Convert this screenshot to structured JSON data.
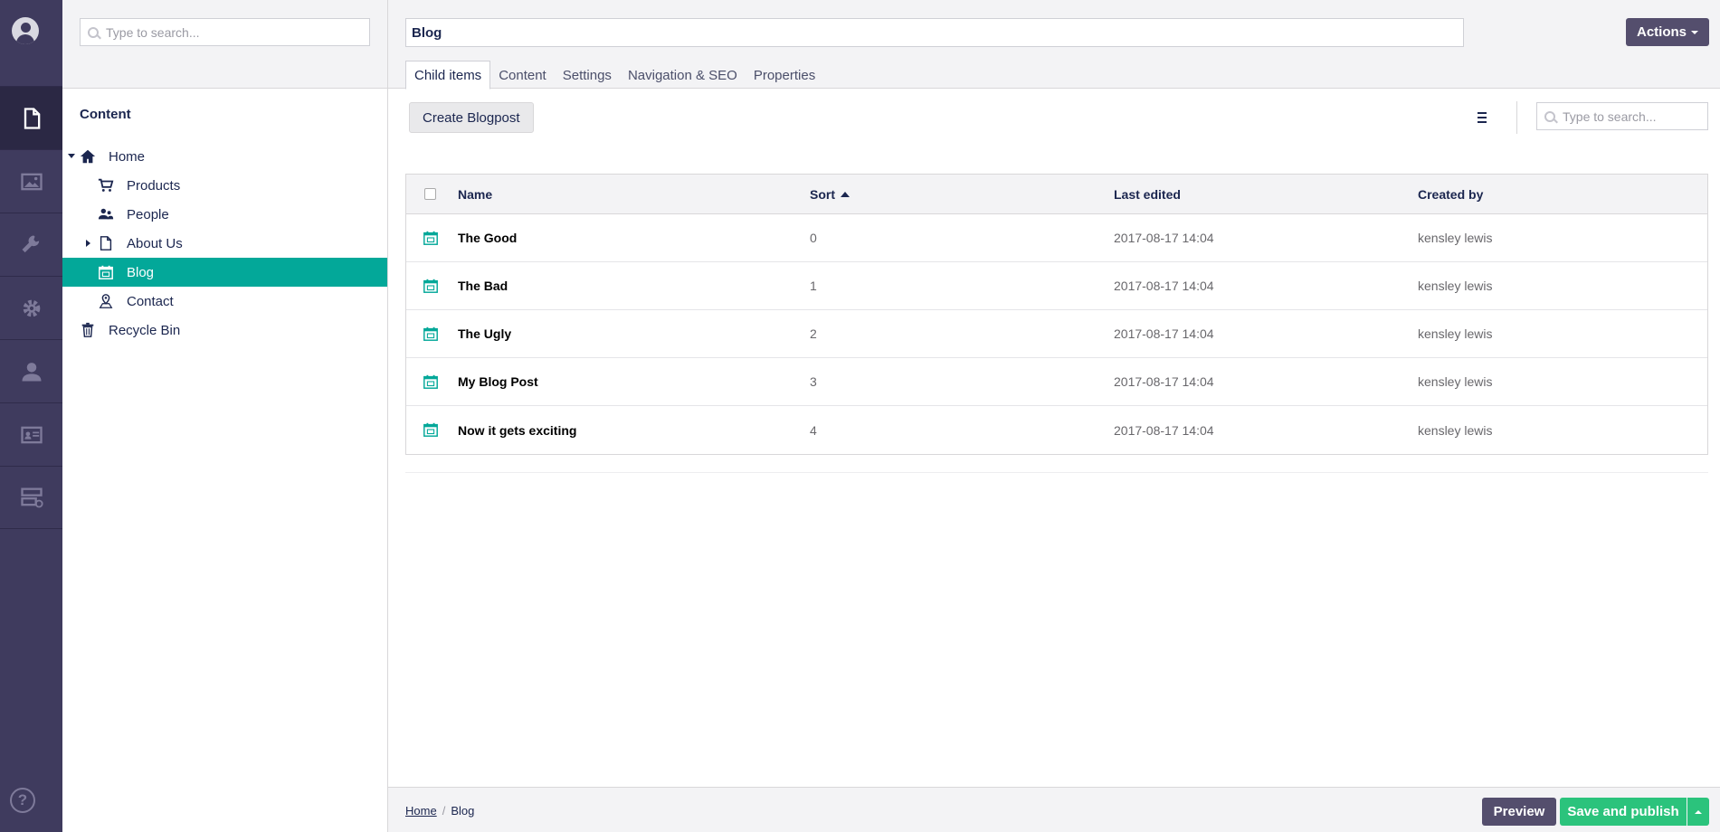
{
  "nav": {
    "sections": [
      {
        "name": "content",
        "icon": "document-icon",
        "active": true
      },
      {
        "name": "media",
        "icon": "image-icon"
      },
      {
        "name": "settings",
        "icon": "wrench-icon"
      },
      {
        "name": "developer",
        "icon": "gear-icon"
      },
      {
        "name": "users",
        "icon": "user-icon"
      },
      {
        "name": "members",
        "icon": "id-card-icon"
      },
      {
        "name": "forms",
        "icon": "server-icon"
      }
    ],
    "help_label": "?"
  },
  "tree": {
    "search_placeholder": "Type to search...",
    "heading": "Content",
    "items": [
      {
        "label": "Home",
        "icon": "home-icon",
        "expanded": true
      },
      {
        "label": "Products",
        "icon": "cart-icon"
      },
      {
        "label": "People",
        "icon": "people-icon"
      },
      {
        "label": "About Us",
        "icon": "document-icon",
        "collapsed": true
      },
      {
        "label": "Blog",
        "icon": "calendar-icon",
        "selected": true
      },
      {
        "label": "Contact",
        "icon": "map-pin-icon"
      },
      {
        "label": "Recycle Bin",
        "icon": "trash-icon"
      }
    ]
  },
  "editor": {
    "name_value": "Blog",
    "actions_label": "Actions",
    "tabs": [
      "Child items",
      "Content",
      "Settings",
      "Navigation & SEO",
      "Properties"
    ],
    "create_button": "Create Blogpost",
    "list_search_placeholder": "Type to search...",
    "columns": {
      "name": "Name",
      "sort": "Sort",
      "last_edited": "Last edited",
      "created_by": "Created by"
    },
    "rows": [
      {
        "name": "The Good",
        "sort": "0",
        "last_edited": "2017-08-17 14:04",
        "created_by": "kensley lewis"
      },
      {
        "name": "The Bad",
        "sort": "1",
        "last_edited": "2017-08-17 14:04",
        "created_by": "kensley lewis"
      },
      {
        "name": "The Ugly",
        "sort": "2",
        "last_edited": "2017-08-17 14:04",
        "created_by": "kensley lewis"
      },
      {
        "name": "My Blog Post",
        "sort": "3",
        "last_edited": "2017-08-17 14:04",
        "created_by": "kensley lewis"
      },
      {
        "name": "Now it gets exciting",
        "sort": "4",
        "last_edited": "2017-08-17 14:04",
        "created_by": "kensley lewis"
      }
    ]
  },
  "footer": {
    "breadcrumb": [
      "Home",
      "Blog"
    ],
    "breadcrumb_sep": "/",
    "preview_label": "Preview",
    "save_label": "Save and publish"
  },
  "colors": {
    "rail": "#3f3b5e",
    "selected": "#03a899",
    "primary_button": "#544e6d",
    "success": "#2bc37c"
  }
}
